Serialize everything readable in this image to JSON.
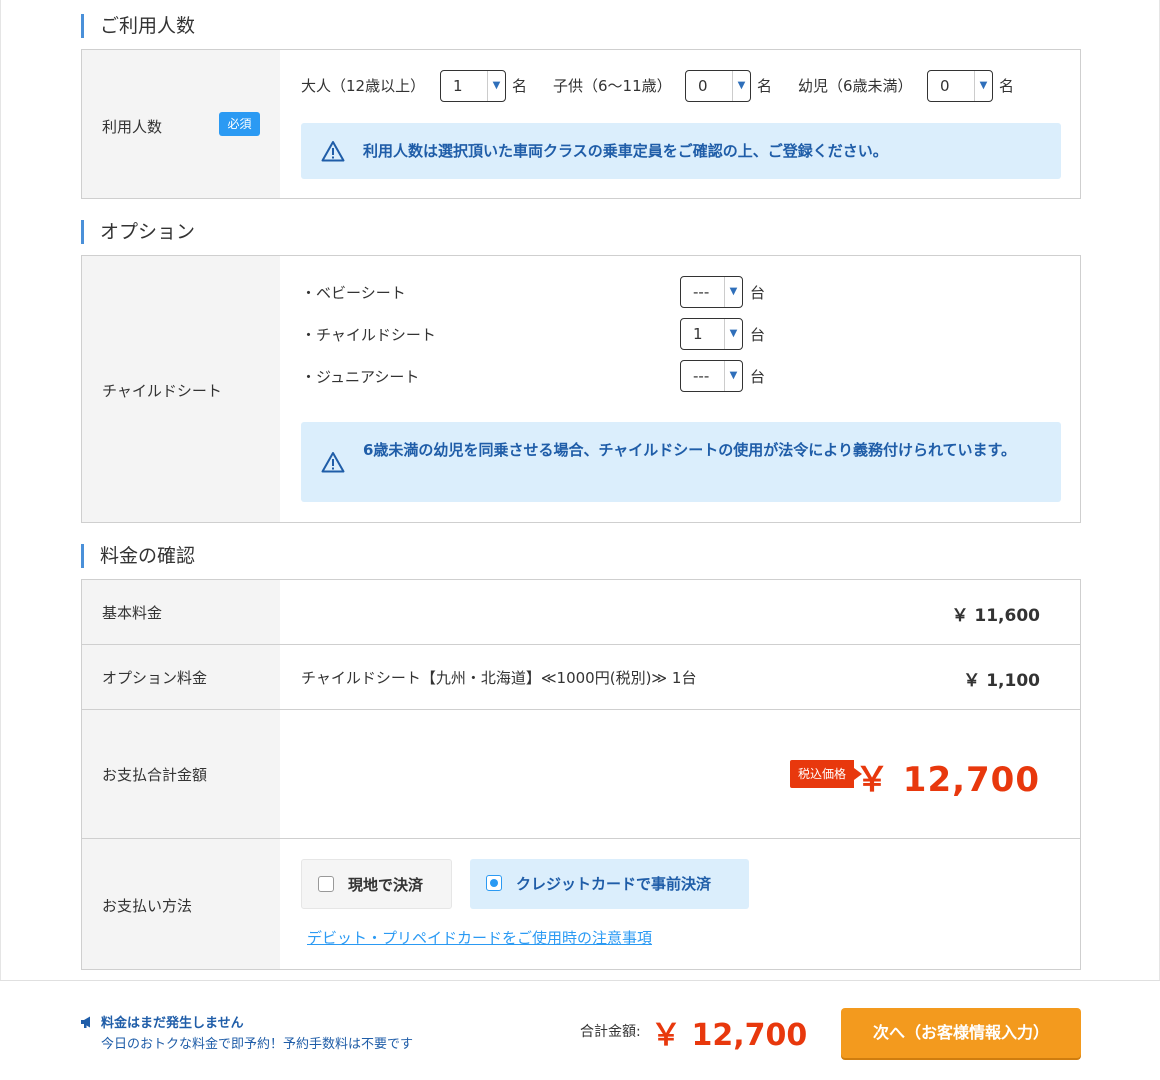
{
  "sections": {
    "people_title": "ご利用人数",
    "options_title": "オプション",
    "fee_title": "料金の確認"
  },
  "people": {
    "label": "利用人数",
    "required_badge": "必須",
    "adult_label": "大人（12歳以上）",
    "adult_value": "1",
    "child_label": "子供（6〜11歳）",
    "child_value": "0",
    "infant_label": "幼児（6歳未満）",
    "infant_value": "0",
    "unit": "名",
    "notice": "利用人数は選択頂いた車両クラスの乗車定員をご確認の上、ご登録ください。"
  },
  "options": {
    "label": "チャイルドシート",
    "items": [
      {
        "name": "・ベビーシート",
        "value": "---"
      },
      {
        "name": "・チャイルドシート",
        "value": "1"
      },
      {
        "name": "・ジュニアシート",
        "value": "---"
      }
    ],
    "unit": "台",
    "notice": "6歳未満の幼児を同乗させる場合、チャイルドシートの使用が法令により義務付けられています。"
  },
  "fees": {
    "base_label": "基本料金",
    "base_price": "￥ 11,600",
    "option_label": "オプション料金",
    "option_desc": "チャイルドシート【九州・北海道】≪1000円(税別)≫ 1台",
    "option_price": "￥ 1,100",
    "total_label": "お支払合計金額",
    "tax_badge": "税込価格",
    "total_price": "￥ 12,700",
    "payment_label": "お支払い方法",
    "pay_onsite": "現地で決済",
    "pay_credit": "クレジットカードで事前決済",
    "pay_link": "デビット・プリペイドカードをご使用時の注意事項"
  },
  "footer": {
    "notice_title": "料金はまだ発生しません",
    "notice_sub": "今日のおトクな料金で即予約！予約手数料は不要です",
    "total_label": "合計金額:",
    "total_price": "￥ 12,700",
    "next_button": "次へ（お客様情報入力）"
  },
  "colors": {
    "accent_blue": "#2b9af3",
    "notice_bg": "#dbeefc",
    "price_red": "#e8380d",
    "button_orange": "#f39a1e"
  }
}
